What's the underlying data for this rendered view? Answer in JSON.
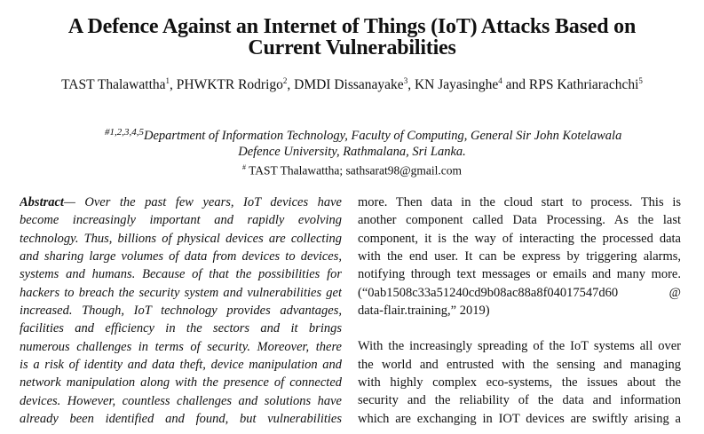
{
  "paper": {
    "title_lines": [
      "A Defence Against an Internet of Things (IoT) Attacks Based on",
      "Current Vulnerabilities"
    ],
    "authors": [
      {
        "name": "TAST Thalawattha",
        "sup": "1",
        "sep": ", "
      },
      {
        "name": "PHWKTR Rodrigo",
        "sup": "2",
        "sep": ", "
      },
      {
        "name": "DMDI Dissanayake",
        "sup": "3",
        "sep": ", "
      },
      {
        "name": "KN Jayasinghe",
        "sup": "4",
        "sep": " and "
      },
      {
        "name": "RPS Kathriarachchi",
        "sup": "5",
        "sep": ""
      }
    ],
    "affiliation": {
      "marker": "#1,2,3,4,5",
      "line1": "Department of Information Technology, Faculty of Computing, General Sir John Kotelawala",
      "line2": "Defence University, Rathmalana, Sri Lanka."
    },
    "corresponding": {
      "marker": "#",
      "text": " TAST Thalawattha; sathsarat98@gmail.com"
    },
    "abstract": {
      "heading": "Abstract",
      "lines": [
        "— Over the past few years, IoT devices have",
        "become increasingly important and rapidly evolving",
        "technology. Thus, billions of physical devices are collecting",
        "and sharing large volumes of data from devices to devices,",
        "systems and humans. Because of that the possibilities for",
        "hackers to breach the security system and vulnerabilities get",
        "increased. Though, IoT technology provides advantages,",
        "facilities and efficiency in the sectors and it brings",
        "numerous challenges in terms of security. Moreover, there",
        "is a risk of identity and data theft, device manipulation and",
        "network manipulation along with the presence of connected",
        "devices. However, countless challenges and solutions have",
        "already been identified and found, but vulnerabilities"
      ]
    },
    "right_column": {
      "para1_lines": [
        "more. Then data in the cloud start to process. This is",
        "another component called Data Processing. As the last",
        "component, it is the way of interacting the processed data",
        "with the end user. It can be express by triggering alarms,",
        "notifying through text messages or emails and many more.",
        "(“0ab1508c33a51240cd9b08ac88a8f04017547d60          @",
        "data-flair.training,” 2019)"
      ],
      "para2_lines": [
        "With the increasingly spreading of the IoT systems all over",
        "the world and entrusted with the sensing and managing",
        "with highly complex eco-systems, the issues about the",
        "security and the reliability of the data and information",
        "which are exchanging in IOT devices are swiftly arising a"
      ]
    }
  }
}
